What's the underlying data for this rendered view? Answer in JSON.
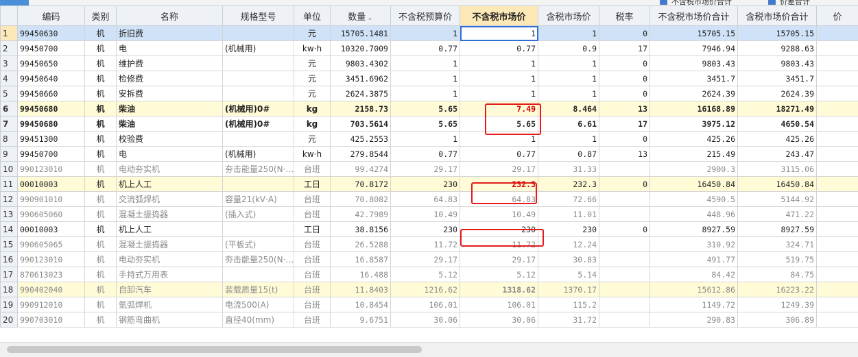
{
  "topbar": {
    "checkbox1_label": "不含税市场价合计",
    "checkbox2_label": "价差合计"
  },
  "columns": [
    "",
    "编码",
    "类别",
    "名称",
    "规格型号",
    "单位",
    "数量",
    "不含税预算价",
    "不含税市场价",
    "含税市场价",
    "税率",
    "不含税市场价合计",
    "含税市场价合计",
    "价"
  ],
  "sort_icon": "chevron-down-icon",
  "rows": [
    {
      "no": "1",
      "code": "99450630",
      "type": "机",
      "name": "折旧费",
      "spec": "",
      "unit": "元",
      "qty": "15705.1481",
      "budget": "1",
      "market": "1",
      "tax_market": "1",
      "rate": "0",
      "total": "15705.15",
      "tax_total": "15705.15",
      "style": "sel"
    },
    {
      "no": "2",
      "code": "99450700",
      "type": "机",
      "name": "电",
      "spec": "(机械用)",
      "unit": "kw·h",
      "qty": "10320.7009",
      "budget": "0.77",
      "market": "0.77",
      "tax_market": "0.9",
      "rate": "17",
      "total": "7946.94",
      "tax_total": "9288.63",
      "style": ""
    },
    {
      "no": "3",
      "code": "99450650",
      "type": "机",
      "name": "维护费",
      "spec": "",
      "unit": "元",
      "qty": "9803.4302",
      "budget": "1",
      "market": "1",
      "tax_market": "1",
      "rate": "0",
      "total": "9803.43",
      "tax_total": "9803.43",
      "style": ""
    },
    {
      "no": "4",
      "code": "99450640",
      "type": "机",
      "name": "检修费",
      "spec": "",
      "unit": "元",
      "qty": "3451.6962",
      "budget": "1",
      "market": "1",
      "tax_market": "1",
      "rate": "0",
      "total": "3451.7",
      "tax_total": "3451.7",
      "style": ""
    },
    {
      "no": "5",
      "code": "99450660",
      "type": "机",
      "name": "安拆费",
      "spec": "",
      "unit": "元",
      "qty": "2624.3875",
      "budget": "1",
      "market": "1",
      "tax_market": "1",
      "rate": "0",
      "total": "2624.39",
      "tax_total": "2624.39",
      "style": ""
    },
    {
      "no": "6",
      "code": "99450680",
      "type": "机",
      "name": "柴油",
      "spec": "(机械用)0#",
      "unit": "kg",
      "qty": "2158.73",
      "budget": "5.65",
      "market": "7.49",
      "tax_market": "8.464",
      "rate": "13",
      "total": "16168.89",
      "tax_total": "18271.49",
      "style": "yel bold",
      "market_red": true
    },
    {
      "no": "7",
      "code": "99450680",
      "type": "机",
      "name": "柴油",
      "spec": "(机械用)0#",
      "unit": "kg",
      "qty": "703.5614",
      "budget": "5.65",
      "market": "5.65",
      "tax_market": "6.61",
      "rate": "17",
      "total": "3975.12",
      "tax_total": "4650.54",
      "style": "bold"
    },
    {
      "no": "8",
      "code": "99451300",
      "type": "机",
      "name": "校验费",
      "spec": "",
      "unit": "元",
      "qty": "425.2553",
      "budget": "1",
      "market": "1",
      "tax_market": "1",
      "rate": "0",
      "total": "425.26",
      "tax_total": "425.26",
      "style": ""
    },
    {
      "no": "9",
      "code": "99450700",
      "type": "机",
      "name": "电",
      "spec": "(机械用)",
      "unit": "kw·h",
      "qty": "279.8544",
      "budget": "0.77",
      "market": "0.77",
      "tax_market": "0.87",
      "rate": "13",
      "total": "215.49",
      "tax_total": "243.47",
      "style": ""
    },
    {
      "no": "10",
      "code": "990123010",
      "type": "机",
      "name": "电动夯实机",
      "spec": "夯击能量250(N·…",
      "unit": "台班",
      "qty": "99.4274",
      "budget": "29.17",
      "market": "29.17",
      "tax_market": "31.33",
      "rate": "",
      "total": "2900.3",
      "tax_total": "3115.06",
      "style": "gray"
    },
    {
      "no": "11",
      "code": "00010003",
      "type": "机",
      "name": "机上人工",
      "spec": "",
      "unit": "工日",
      "qty": "70.8172",
      "budget": "230",
      "market": "232.3",
      "tax_market": "232.3",
      "rate": "0",
      "total": "16450.84",
      "tax_total": "16450.84",
      "style": "yel",
      "market_red": true
    },
    {
      "no": "12",
      "code": "990901010",
      "type": "机",
      "name": "交流弧焊机",
      "spec": "容量21(kV·A)",
      "unit": "台班",
      "qty": "70.8082",
      "budget": "64.83",
      "market": "64.83",
      "tax_market": "72.66",
      "rate": "",
      "total": "4590.5",
      "tax_total": "5144.92",
      "style": "gray"
    },
    {
      "no": "13",
      "code": "990605060",
      "type": "机",
      "name": "混凝土振捣器",
      "spec": "(插入式)",
      "unit": "台班",
      "qty": "42.7989",
      "budget": "10.49",
      "market": "10.49",
      "tax_market": "11.01",
      "rate": "",
      "total": "448.96",
      "tax_total": "471.22",
      "style": "gray"
    },
    {
      "no": "14",
      "code": "00010003",
      "type": "机",
      "name": "机上人工",
      "spec": "",
      "unit": "工日",
      "qty": "38.8156",
      "budget": "230",
      "market": "230",
      "tax_market": "230",
      "rate": "0",
      "total": "8927.59",
      "tax_total": "8927.59",
      "style": ""
    },
    {
      "no": "15",
      "code": "990605065",
      "type": "机",
      "name": "混凝土振捣器",
      "spec": "(平板式)",
      "unit": "台班",
      "qty": "26.5288",
      "budget": "11.72",
      "market": "11.72",
      "tax_market": "12.24",
      "rate": "",
      "total": "310.92",
      "tax_total": "324.71",
      "style": "gray"
    },
    {
      "no": "16",
      "code": "990123010",
      "type": "机",
      "name": "电动夯实机",
      "spec": "夯击能量250(N·…",
      "unit": "台班",
      "qty": "16.8587",
      "budget": "29.17",
      "market": "29.17",
      "tax_market": "30.83",
      "rate": "",
      "total": "491.77",
      "tax_total": "519.75",
      "style": "gray"
    },
    {
      "no": "17",
      "code": "870613023",
      "type": "机",
      "name": "手持式万用表",
      "spec": "",
      "unit": "台班",
      "qty": "16.488",
      "budget": "5.12",
      "market": "5.12",
      "tax_market": "5.14",
      "rate": "",
      "total": "84.42",
      "tax_total": "84.75",
      "style": "gray"
    },
    {
      "no": "18",
      "code": "990402040",
      "type": "机",
      "name": "自卸汽车",
      "spec": "装载质量15(t)",
      "unit": "台班",
      "qty": "11.8403",
      "budget": "1216.62",
      "market": "1318.62",
      "tax_market": "1370.17",
      "rate": "",
      "total": "15612.86",
      "tax_total": "16223.22",
      "style": "yel gray",
      "market_bold": true
    },
    {
      "no": "19",
      "code": "990912010",
      "type": "机",
      "name": "氩弧焊机",
      "spec": "电流500(A)",
      "unit": "台班",
      "qty": "10.8454",
      "budget": "106.01",
      "market": "106.01",
      "tax_market": "115.2",
      "rate": "",
      "total": "1149.72",
      "tax_total": "1249.39",
      "style": "gray"
    },
    {
      "no": "20",
      "code": "990703010",
      "type": "机",
      "name": "钢筋弯曲机",
      "spec": "直径40(mm)",
      "unit": "台班",
      "qty": "9.6751",
      "budget": "30.06",
      "market": "30.06",
      "tax_market": "31.72",
      "rate": "",
      "total": "290.83",
      "tax_total": "306.89",
      "style": "gray"
    }
  ],
  "colors": {
    "selected_row": "#cfe2f7",
    "highlight_row": "#fffbd6",
    "active_header": "#fde8b8",
    "red_text": "#d00000",
    "annotation_box": "#e31b1b"
  }
}
